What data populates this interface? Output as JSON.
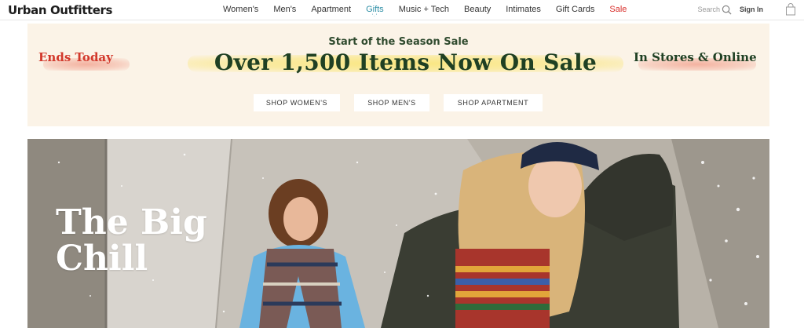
{
  "brand": {
    "logo_text": "Urban Outfitters"
  },
  "nav": {
    "links": [
      {
        "label": "Women's"
      },
      {
        "label": "Men's"
      },
      {
        "label": "Apartment"
      },
      {
        "label": "Gifts"
      },
      {
        "label": "Music + Tech"
      },
      {
        "label": "Beauty"
      },
      {
        "label": "Intimates"
      },
      {
        "label": "Gift Cards"
      },
      {
        "label": "Sale"
      }
    ],
    "search_label": "Search",
    "sign_in": "Sign In",
    "icons": [
      "search-icon",
      "bag-icon"
    ]
  },
  "promo": {
    "pre_headline": "Start of the Season Sale",
    "headline": "Over 1,500 Items Now On Sale",
    "left_text": "Ends Today",
    "right_text": "In Stores & Online",
    "buttons": [
      {
        "label": "SHOP WOMEN'S"
      },
      {
        "label": "SHOP MEN'S"
      },
      {
        "label": "SHOP APARTMENT"
      }
    ],
    "colors": {
      "background": "#fbf3e7",
      "headline": "#1f4023",
      "accent_red": "#d2392c",
      "highlight_yellow": "#fae46e"
    }
  },
  "hero": {
    "title_line1": "The Big",
    "title_line2": "Chill"
  },
  "colors": {
    "sale_link": "#d9302c",
    "gifts_link": "#2d8ea6"
  }
}
